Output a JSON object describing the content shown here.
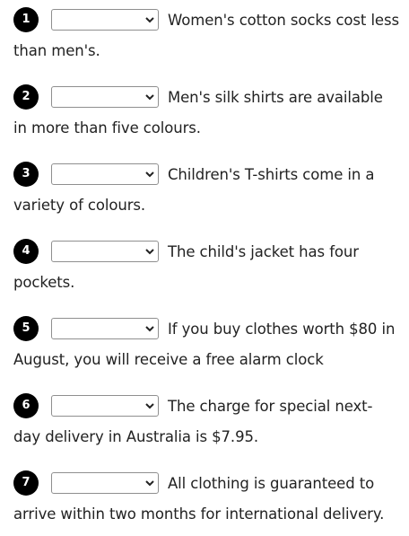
{
  "questions": [
    {
      "number": "1",
      "selected": "",
      "text": "Women's cotton socks cost less than men's."
    },
    {
      "number": "2",
      "selected": "",
      "text": "Men's silk shirts are available in more than five colours."
    },
    {
      "number": "3",
      "selected": "",
      "text": "Children's T-shirts come in a variety of colours."
    },
    {
      "number": "4",
      "selected": "",
      "text": "The child's jacket has four pockets."
    },
    {
      "number": "5",
      "selected": "",
      "text": "If you buy clothes worth $80 in August, you will receive a free alarm clock"
    },
    {
      "number": "6",
      "selected": "",
      "text": "The charge for special next-day delivery in Australia is $7.95."
    },
    {
      "number": "7",
      "selected": "",
      "text": "All clothing is guaranteed to arrive within two months for international delivery."
    }
  ],
  "icons": {
    "dropdown": "chevron-down-icon"
  }
}
